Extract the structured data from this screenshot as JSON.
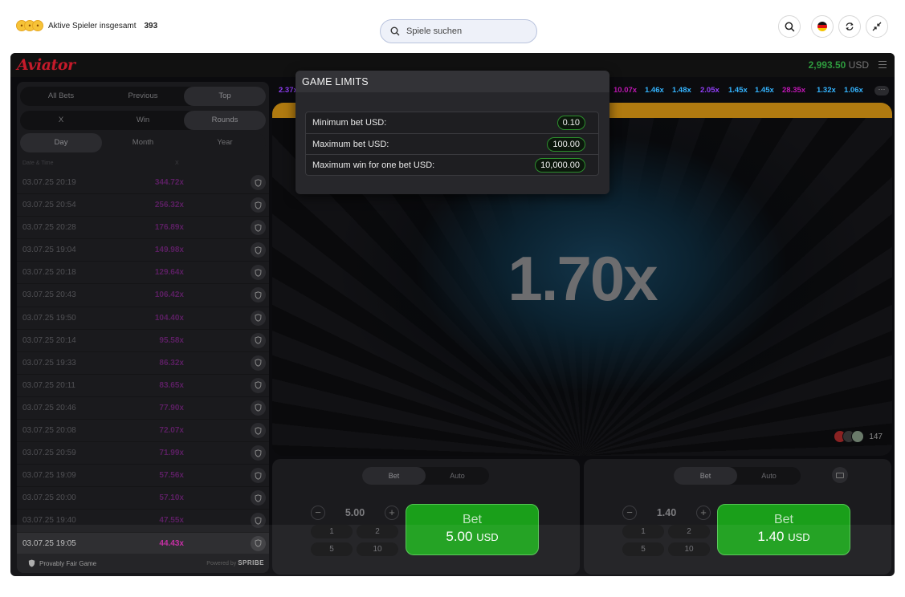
{
  "header": {
    "players_label": "Aktive Spieler insgesamt",
    "players_count": "393",
    "search_placeholder": "Spiele suchen",
    "icons": [
      "emoji-faces",
      "search-icon",
      "flag-de-icon",
      "refresh-icon",
      "collapse-icon"
    ]
  },
  "game": {
    "logo": "Aviator",
    "balance_value": "2,993.50",
    "balance_currency": "USD",
    "bet_tabs": [
      "All Bets",
      "Previous",
      "Top"
    ],
    "filter_tabs": [
      "X",
      "Win",
      "Rounds"
    ],
    "period_tabs": [
      "Day",
      "Month",
      "Year"
    ],
    "columns": [
      "Date & Time",
      "X"
    ],
    "rows": [
      {
        "date": "03.07.25 20:19",
        "mult": "344.72x"
      },
      {
        "date": "03.07.25 20:54",
        "mult": "256.32x"
      },
      {
        "date": "03.07.25 20:28",
        "mult": "176.89x"
      },
      {
        "date": "03.07.25 19:04",
        "mult": "149.98x"
      },
      {
        "date": "03.07.25 20:18",
        "mult": "129.64x"
      },
      {
        "date": "03.07.25 20:43",
        "mult": "106.42x"
      },
      {
        "date": "03.07.25 19:50",
        "mult": "104.40x"
      },
      {
        "date": "03.07.25 20:14",
        "mult": "95.58x"
      },
      {
        "date": "03.07.25 19:33",
        "mult": "86.32x"
      },
      {
        "date": "03.07.25 20:11",
        "mult": "83.65x"
      },
      {
        "date": "03.07.25 20:46",
        "mult": "77.90x"
      },
      {
        "date": "03.07.25 20:08",
        "mult": "72.07x"
      },
      {
        "date": "03.07.25 20:59",
        "mult": "71.99x"
      },
      {
        "date": "03.07.25 19:09",
        "mult": "57.56x"
      },
      {
        "date": "03.07.25 20:00",
        "mult": "57.10x"
      },
      {
        "date": "03.07.25 19:40",
        "mult": "47.55x"
      },
      {
        "date": "03.07.25 19:05",
        "mult": "44.43x"
      }
    ],
    "footer_fair": "Provably Fair Game",
    "footer_powered": "Powered by",
    "footer_brand": "SPRIBE",
    "history": [
      {
        "v": "2.37x",
        "c": "#913ef8"
      },
      {
        "v": "10.07x",
        "c": "#c017b4"
      },
      {
        "v": "1.46x",
        "c": "#34b4ff"
      },
      {
        "v": "1.48x",
        "c": "#34b4ff"
      },
      {
        "v": "2.05x",
        "c": "#913ef8"
      },
      {
        "v": "1.45x",
        "c": "#34b4ff"
      },
      {
        "v": "1.45x",
        "c": "#34b4ff"
      },
      {
        "v": "28.35x",
        "c": "#c017b4"
      },
      {
        "v": "1.32x",
        "c": "#34b4ff"
      },
      {
        "v": "1.06x",
        "c": "#34b4ff"
      }
    ],
    "multiplier": "1.70x",
    "online_count": "147",
    "bet_panels": [
      {
        "tabs": [
          "Bet",
          "Auto"
        ],
        "amount": "5.00",
        "quick": [
          "1",
          "2",
          "5",
          "10"
        ],
        "btn_label": "Bet",
        "btn_amount": "5.00",
        "btn_currency": "USD"
      },
      {
        "tabs": [
          "Bet",
          "Auto"
        ],
        "amount": "1.40",
        "quick": [
          "1",
          "2",
          "5",
          "10"
        ],
        "btn_label": "Bet",
        "btn_amount": "1.40",
        "btn_currency": "USD"
      }
    ]
  },
  "modal": {
    "title": "GAME LIMITS",
    "limits": [
      {
        "label": "Minimum bet USD:",
        "value": "0.10"
      },
      {
        "label": "Maximum bet USD:",
        "value": "100.00"
      },
      {
        "label": "Maximum win for one bet USD:",
        "value": "10,000.00"
      }
    ]
  },
  "colors": {
    "accent_green": "#1a9f1a",
    "brand_red": "#c51a2a",
    "history_blue": "#34b4ff",
    "history_purple": "#913ef8",
    "history_pink": "#c017b4"
  }
}
